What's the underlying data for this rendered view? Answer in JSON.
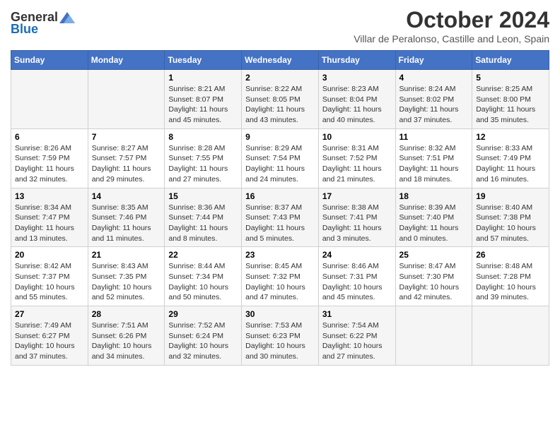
{
  "header": {
    "logo_general": "General",
    "logo_blue": "Blue",
    "title": "October 2024",
    "subtitle": "Villar de Peralonso, Castille and Leon, Spain"
  },
  "columns": [
    "Sunday",
    "Monday",
    "Tuesday",
    "Wednesday",
    "Thursday",
    "Friday",
    "Saturday"
  ],
  "weeks": [
    [
      {
        "day": "",
        "lines": []
      },
      {
        "day": "",
        "lines": []
      },
      {
        "day": "1",
        "lines": [
          "Sunrise: 8:21 AM",
          "Sunset: 8:07 PM",
          "Daylight: 11 hours",
          "and 45 minutes."
        ]
      },
      {
        "day": "2",
        "lines": [
          "Sunrise: 8:22 AM",
          "Sunset: 8:05 PM",
          "Daylight: 11 hours",
          "and 43 minutes."
        ]
      },
      {
        "day": "3",
        "lines": [
          "Sunrise: 8:23 AM",
          "Sunset: 8:04 PM",
          "Daylight: 11 hours",
          "and 40 minutes."
        ]
      },
      {
        "day": "4",
        "lines": [
          "Sunrise: 8:24 AM",
          "Sunset: 8:02 PM",
          "Daylight: 11 hours",
          "and 37 minutes."
        ]
      },
      {
        "day": "5",
        "lines": [
          "Sunrise: 8:25 AM",
          "Sunset: 8:00 PM",
          "Daylight: 11 hours",
          "and 35 minutes."
        ]
      }
    ],
    [
      {
        "day": "6",
        "lines": [
          "Sunrise: 8:26 AM",
          "Sunset: 7:59 PM",
          "Daylight: 11 hours",
          "and 32 minutes."
        ]
      },
      {
        "day": "7",
        "lines": [
          "Sunrise: 8:27 AM",
          "Sunset: 7:57 PM",
          "Daylight: 11 hours",
          "and 29 minutes."
        ]
      },
      {
        "day": "8",
        "lines": [
          "Sunrise: 8:28 AM",
          "Sunset: 7:55 PM",
          "Daylight: 11 hours",
          "and 27 minutes."
        ]
      },
      {
        "day": "9",
        "lines": [
          "Sunrise: 8:29 AM",
          "Sunset: 7:54 PM",
          "Daylight: 11 hours",
          "and 24 minutes."
        ]
      },
      {
        "day": "10",
        "lines": [
          "Sunrise: 8:31 AM",
          "Sunset: 7:52 PM",
          "Daylight: 11 hours",
          "and 21 minutes."
        ]
      },
      {
        "day": "11",
        "lines": [
          "Sunrise: 8:32 AM",
          "Sunset: 7:51 PM",
          "Daylight: 11 hours",
          "and 18 minutes."
        ]
      },
      {
        "day": "12",
        "lines": [
          "Sunrise: 8:33 AM",
          "Sunset: 7:49 PM",
          "Daylight: 11 hours",
          "and 16 minutes."
        ]
      }
    ],
    [
      {
        "day": "13",
        "lines": [
          "Sunrise: 8:34 AM",
          "Sunset: 7:47 PM",
          "Daylight: 11 hours",
          "and 13 minutes."
        ]
      },
      {
        "day": "14",
        "lines": [
          "Sunrise: 8:35 AM",
          "Sunset: 7:46 PM",
          "Daylight: 11 hours",
          "and 11 minutes."
        ]
      },
      {
        "day": "15",
        "lines": [
          "Sunrise: 8:36 AM",
          "Sunset: 7:44 PM",
          "Daylight: 11 hours",
          "and 8 minutes."
        ]
      },
      {
        "day": "16",
        "lines": [
          "Sunrise: 8:37 AM",
          "Sunset: 7:43 PM",
          "Daylight: 11 hours",
          "and 5 minutes."
        ]
      },
      {
        "day": "17",
        "lines": [
          "Sunrise: 8:38 AM",
          "Sunset: 7:41 PM",
          "Daylight: 11 hours",
          "and 3 minutes."
        ]
      },
      {
        "day": "18",
        "lines": [
          "Sunrise: 8:39 AM",
          "Sunset: 7:40 PM",
          "Daylight: 11 hours",
          "and 0 minutes."
        ]
      },
      {
        "day": "19",
        "lines": [
          "Sunrise: 8:40 AM",
          "Sunset: 7:38 PM",
          "Daylight: 10 hours",
          "and 57 minutes."
        ]
      }
    ],
    [
      {
        "day": "20",
        "lines": [
          "Sunrise: 8:42 AM",
          "Sunset: 7:37 PM",
          "Daylight: 10 hours",
          "and 55 minutes."
        ]
      },
      {
        "day": "21",
        "lines": [
          "Sunrise: 8:43 AM",
          "Sunset: 7:35 PM",
          "Daylight: 10 hours",
          "and 52 minutes."
        ]
      },
      {
        "day": "22",
        "lines": [
          "Sunrise: 8:44 AM",
          "Sunset: 7:34 PM",
          "Daylight: 10 hours",
          "and 50 minutes."
        ]
      },
      {
        "day": "23",
        "lines": [
          "Sunrise: 8:45 AM",
          "Sunset: 7:32 PM",
          "Daylight: 10 hours",
          "and 47 minutes."
        ]
      },
      {
        "day": "24",
        "lines": [
          "Sunrise: 8:46 AM",
          "Sunset: 7:31 PM",
          "Daylight: 10 hours",
          "and 45 minutes."
        ]
      },
      {
        "day": "25",
        "lines": [
          "Sunrise: 8:47 AM",
          "Sunset: 7:30 PM",
          "Daylight: 10 hours",
          "and 42 minutes."
        ]
      },
      {
        "day": "26",
        "lines": [
          "Sunrise: 8:48 AM",
          "Sunset: 7:28 PM",
          "Daylight: 10 hours",
          "and 39 minutes."
        ]
      }
    ],
    [
      {
        "day": "27",
        "lines": [
          "Sunrise: 7:49 AM",
          "Sunset: 6:27 PM",
          "Daylight: 10 hours",
          "and 37 minutes."
        ]
      },
      {
        "day": "28",
        "lines": [
          "Sunrise: 7:51 AM",
          "Sunset: 6:26 PM",
          "Daylight: 10 hours",
          "and 34 minutes."
        ]
      },
      {
        "day": "29",
        "lines": [
          "Sunrise: 7:52 AM",
          "Sunset: 6:24 PM",
          "Daylight: 10 hours",
          "and 32 minutes."
        ]
      },
      {
        "day": "30",
        "lines": [
          "Sunrise: 7:53 AM",
          "Sunset: 6:23 PM",
          "Daylight: 10 hours",
          "and 30 minutes."
        ]
      },
      {
        "day": "31",
        "lines": [
          "Sunrise: 7:54 AM",
          "Sunset: 6:22 PM",
          "Daylight: 10 hours",
          "and 27 minutes."
        ]
      },
      {
        "day": "",
        "lines": []
      },
      {
        "day": "",
        "lines": []
      }
    ]
  ]
}
